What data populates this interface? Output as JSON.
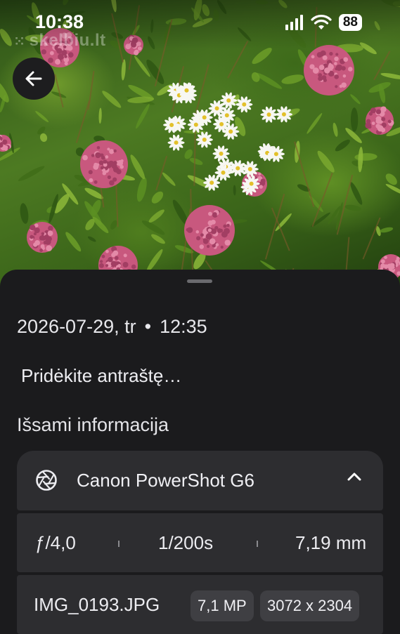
{
  "status_bar": {
    "time": "10:38",
    "battery": "88",
    "icons": [
      "signal-icon",
      "wifi-icon",
      "battery-icon"
    ]
  },
  "photo": {
    "watermark": "skelbiu.lt",
    "subject": "pink and white flowers"
  },
  "sheet": {
    "date": "2026-07-29, tr",
    "separator": "•",
    "time": "12:35",
    "caption_placeholder": "Pridėkite antraštę…",
    "details_title": "Išsami informacija",
    "camera": {
      "name": "Canon PowerShot G6",
      "icon": "aperture-icon",
      "expand_icon": "chevron-up-icon"
    },
    "exif": {
      "aperture": "ƒ/4,0",
      "shutter": "1/200s",
      "focal_length": "7,19 mm"
    },
    "file": {
      "name": "IMG_0193.JPG",
      "megapixels": "7,1 MP",
      "resolution": "3072 x 2304"
    }
  },
  "colors": {
    "sheet_bg": "#1b1b1d",
    "card_bg": "#2d2d30",
    "chip_bg": "#3f3f43",
    "text": "#ececf0"
  }
}
